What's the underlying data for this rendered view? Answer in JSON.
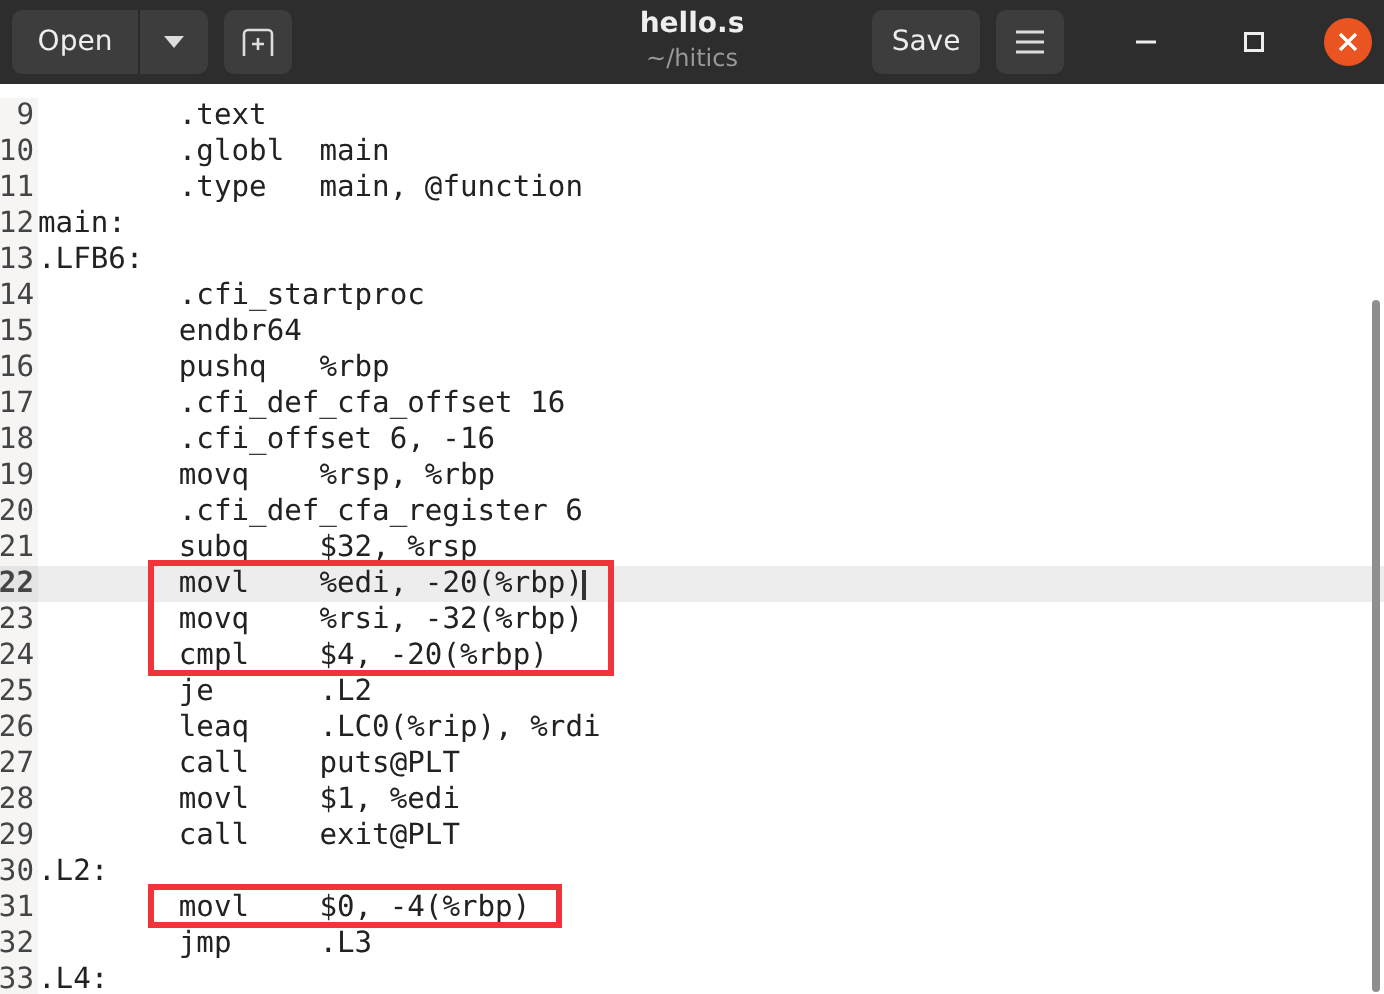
{
  "window": {
    "title": "hello.s",
    "subtitle": "~/hitics"
  },
  "header": {
    "open_label": "Open",
    "save_label": "Save"
  },
  "editor": {
    "lines": [
      {
        "num": "9",
        "indented": true,
        "text": ".text",
        "current": false,
        "annotated": false
      },
      {
        "num": "10",
        "indented": true,
        "text": ".globl\tmain",
        "current": false,
        "annotated": false
      },
      {
        "num": "11",
        "indented": true,
        "text": ".type\tmain, @function",
        "current": false,
        "annotated": false
      },
      {
        "num": "12",
        "indented": false,
        "text": "main:",
        "current": false,
        "annotated": false
      },
      {
        "num": "13",
        "indented": false,
        "text": ".LFB6:",
        "current": false,
        "annotated": false
      },
      {
        "num": "14",
        "indented": true,
        "text": ".cfi_startproc",
        "current": false,
        "annotated": false
      },
      {
        "num": "15",
        "indented": true,
        "text": "endbr64",
        "current": false,
        "annotated": false
      },
      {
        "num": "16",
        "indented": true,
        "text": "pushq\t%rbp",
        "current": false,
        "annotated": false
      },
      {
        "num": "17",
        "indented": true,
        "text": ".cfi_def_cfa_offset 16",
        "current": false,
        "annotated": false
      },
      {
        "num": "18",
        "indented": true,
        "text": ".cfi_offset 6, -16",
        "current": false,
        "annotated": false
      },
      {
        "num": "19",
        "indented": true,
        "text": "movq\t%rsp, %rbp",
        "current": false,
        "annotated": false
      },
      {
        "num": "20",
        "indented": true,
        "text": ".cfi_def_cfa_register 6",
        "current": false,
        "annotated": false
      },
      {
        "num": "21",
        "indented": true,
        "text": "subq\t$32, %rsp",
        "current": false,
        "annotated": false
      },
      {
        "num": "22",
        "indented": true,
        "text": "movl\t%edi, -20(%rbp)",
        "current": true,
        "annotated": true
      },
      {
        "num": "23",
        "indented": true,
        "text": "movq\t%rsi, -32(%rbp)",
        "current": false,
        "annotated": true
      },
      {
        "num": "24",
        "indented": true,
        "text": "cmpl\t$4, -20(%rbp)",
        "current": false,
        "annotated": true
      },
      {
        "num": "25",
        "indented": true,
        "text": "je\t.L2",
        "current": false,
        "annotated": false
      },
      {
        "num": "26",
        "indented": true,
        "text": "leaq\t.LC0(%rip), %rdi",
        "current": false,
        "annotated": false
      },
      {
        "num": "27",
        "indented": true,
        "text": "call\tputs@PLT",
        "current": false,
        "annotated": false
      },
      {
        "num": "28",
        "indented": true,
        "text": "movl\t$1, %edi",
        "current": false,
        "annotated": false
      },
      {
        "num": "29",
        "indented": true,
        "text": "call\texit@PLT",
        "current": false,
        "annotated": false
      },
      {
        "num": "30",
        "indented": false,
        "text": ".L2:",
        "current": false,
        "annotated": false
      },
      {
        "num": "31",
        "indented": true,
        "text": "movl\t$0, -4(%rbp)",
        "current": false,
        "annotated": true
      },
      {
        "num": "32",
        "indented": true,
        "text": "jmp\t.L3",
        "current": false,
        "annotated": false
      },
      {
        "num": "33",
        "indented": false,
        "text": ".L4:",
        "current": false,
        "annotated": false
      }
    ]
  }
}
